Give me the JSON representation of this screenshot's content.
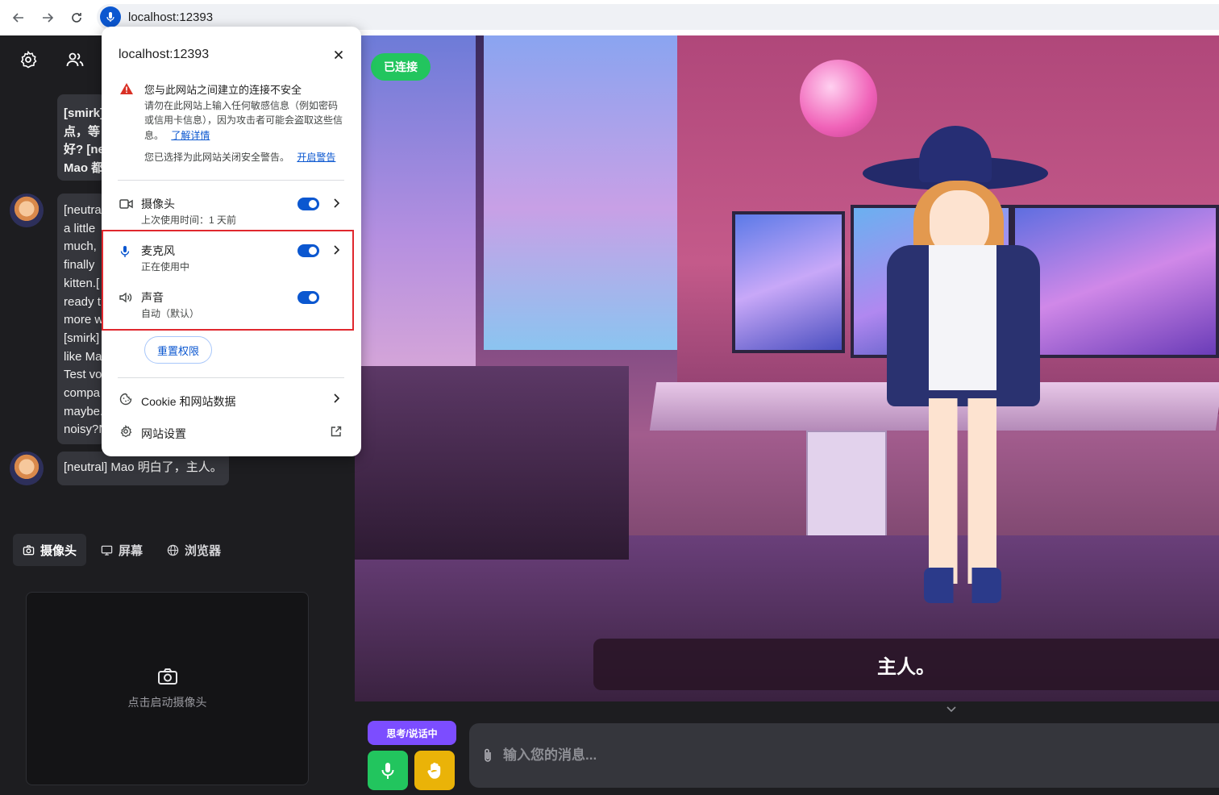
{
  "browser": {
    "url": "localhost:12393",
    "back_icon": "arrow-left-icon",
    "forward_icon": "arrow-right-icon",
    "reload_icon": "reload-icon",
    "site_icon": "microphone-icon"
  },
  "site_popup": {
    "title": "localhost:12393",
    "warning_title": "您与此网站之间建立的连接不安全",
    "warning_body": "请勿在此网站上输入任何敏感信息（例如密码或信用卡信息），因为攻击者可能会盗取这些信息。",
    "learn_more": "了解详情",
    "warning_note": "您已选择为此网站关闭安全警告。",
    "enable_warning": "开启警告",
    "permissions": [
      {
        "name": "摄像头",
        "detail": "上次使用时间：1 天前",
        "enabled": true,
        "icon": "camera-icon"
      },
      {
        "name": "麦克风",
        "detail": "正在使用中",
        "enabled": true,
        "icon": "microphone-icon"
      },
      {
        "name": "声音",
        "detail": "自动（默认）",
        "enabled": true,
        "icon": "speaker-icon"
      }
    ],
    "reset_button": "重置权限",
    "cookie_row": "Cookie 和网站数据",
    "site_settings_row": "网站设置",
    "highlight_color": "#e0282e"
  },
  "chat": {
    "messages": [
      {
        "text": "[smirk] \n点，等\n好? [ne\nMao 都"
      },
      {
        "text": "[neutra\na little \nmuch, \nfinally \nkitten.[\nready t\nmore w\n[smirk]\nlike Ma\nTest vo\ncompa\nmaybe.\nnoisy?N"
      },
      {
        "text": "[neutral] Mao 明白了，主人。"
      }
    ]
  },
  "media_tabs": [
    {
      "label": "摄像头",
      "active": true,
      "icon": "camera-icon"
    },
    {
      "label": "屏幕",
      "active": false,
      "icon": "monitor-icon"
    },
    {
      "label": "浏览器",
      "active": false,
      "icon": "globe-icon"
    }
  ],
  "camera_panel": {
    "hint": "点击启动摄像头",
    "icon": "camera-icon"
  },
  "stage": {
    "status": "已连接",
    "subtitle": "主人。"
  },
  "controls": {
    "state_label": "思考/说话中",
    "input_placeholder": "输入您的消息...",
    "mic_color": "#22c55e",
    "interrupt_color": "#eab308",
    "state_color": "#7c4dff"
  }
}
